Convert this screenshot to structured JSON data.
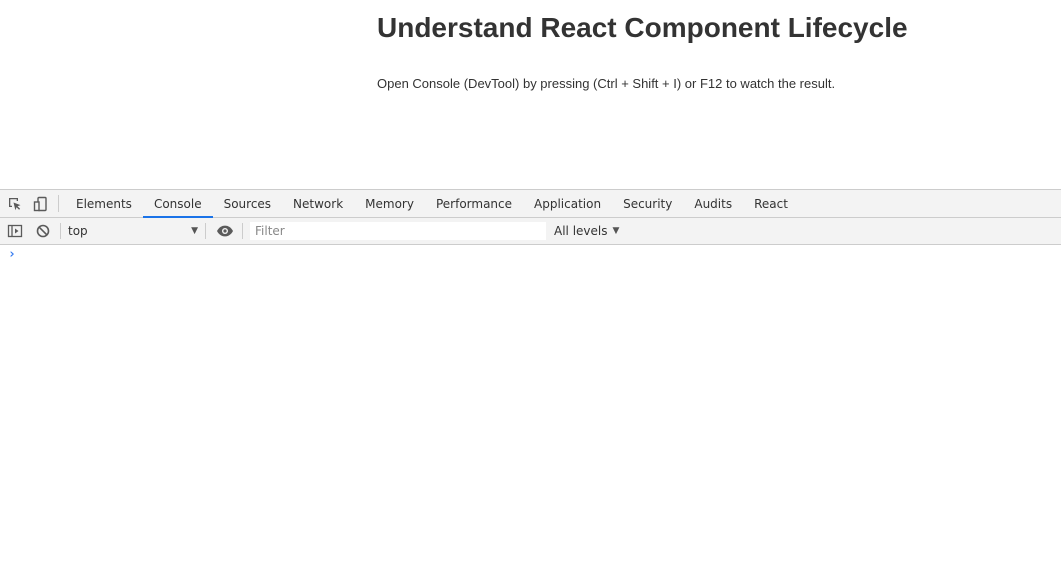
{
  "page": {
    "title": "Understand React Component Lifecycle",
    "description": "Open Console (DevTool) by pressing (Ctrl + Shift + I) or F12 to watch the result."
  },
  "devtools": {
    "tabs": [
      {
        "label": "Elements"
      },
      {
        "label": "Console",
        "active": true
      },
      {
        "label": "Sources"
      },
      {
        "label": "Network"
      },
      {
        "label": "Memory"
      },
      {
        "label": "Performance"
      },
      {
        "label": "Application"
      },
      {
        "label": "Security"
      },
      {
        "label": "Audits"
      },
      {
        "label": "React"
      }
    ],
    "toolbar_icons": {
      "inspect": "inspect-element-icon",
      "device": "device-toolbar-icon"
    },
    "console": {
      "context": "top",
      "filter_placeholder": "Filter",
      "filter_value": "",
      "levels": "All levels",
      "prompt": "›",
      "icons": {
        "sidebar": "show-sidebar-icon",
        "clear": "clear-console-icon",
        "live_expression": "eye-icon"
      }
    },
    "colors": {
      "accent": "#1a73e8",
      "prompt": "#367cf1",
      "toolbar_bg": "#f3f3f3",
      "border": "#cccccc"
    }
  }
}
